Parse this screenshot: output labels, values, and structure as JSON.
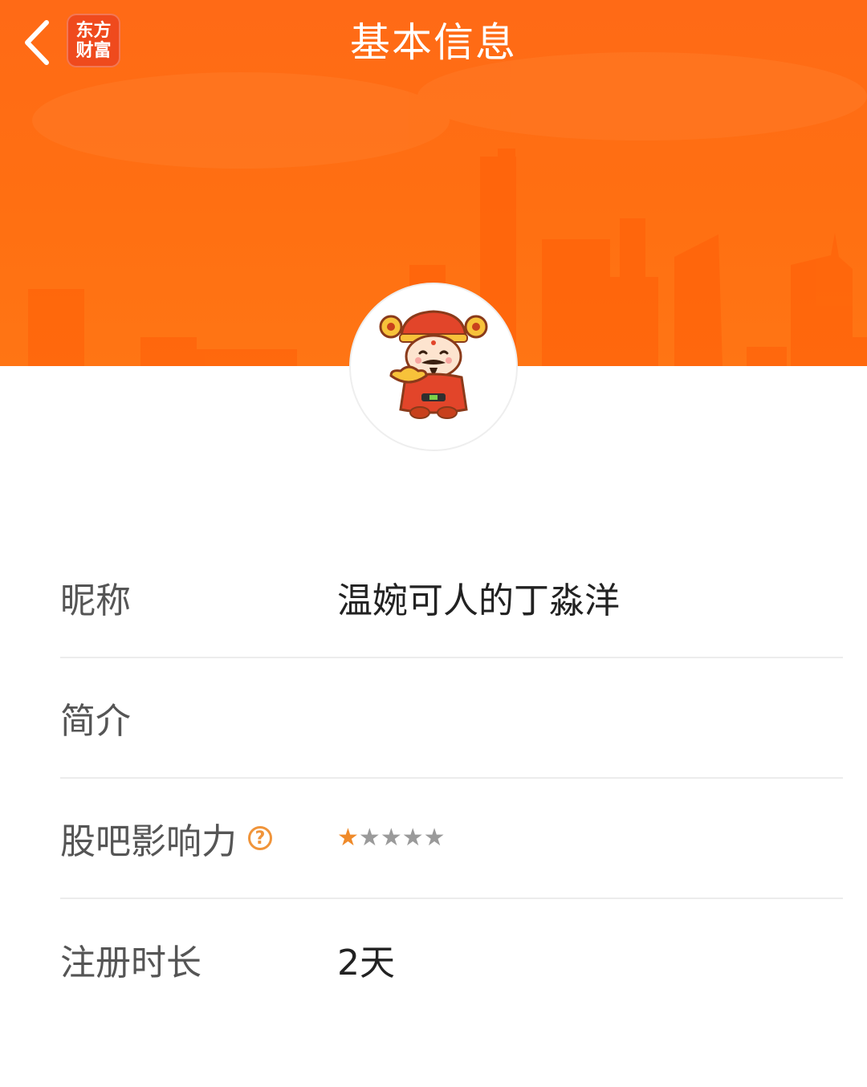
{
  "header": {
    "title": "基本信息",
    "back_icon": "chevron-left-icon",
    "logo": {
      "line1": "东方",
      "line2": "财富"
    },
    "banner_color": "#ff6a16"
  },
  "profile": {
    "avatar_icon": "god-of-wealth-avatar"
  },
  "info": {
    "nickname": {
      "label": "昵称",
      "value": "温婉可人的丁淼洋"
    },
    "bio": {
      "label": "简介",
      "value": ""
    },
    "influence": {
      "label": "股吧影响力",
      "help_icon": "question-icon",
      "rating": 1,
      "max_rating": 5,
      "star_color": "#ef8a2a"
    },
    "registered": {
      "label": "注册时长",
      "value": "2天"
    }
  }
}
